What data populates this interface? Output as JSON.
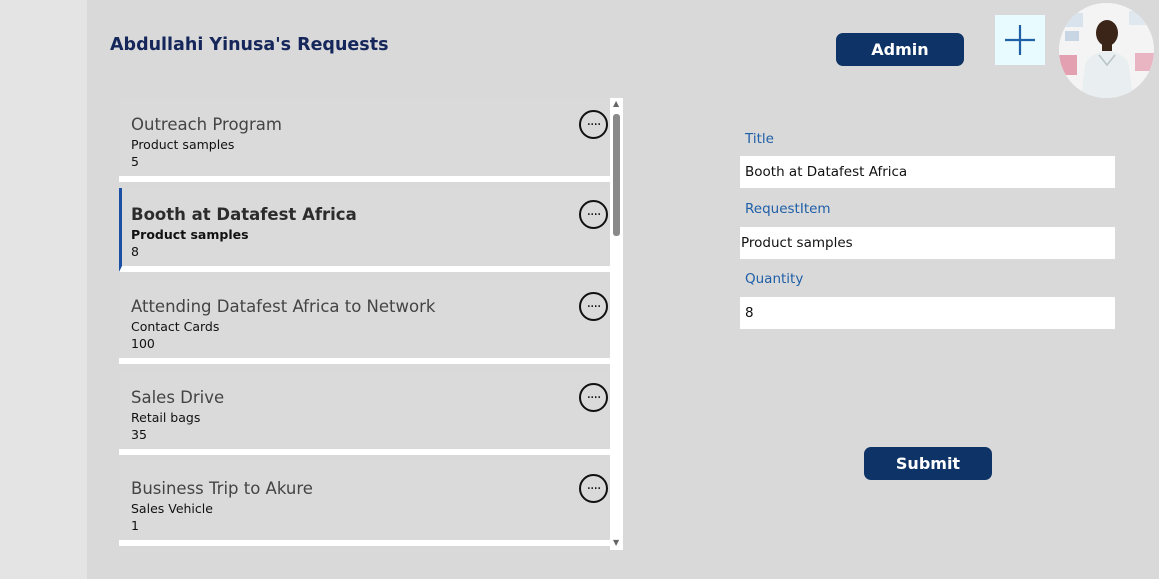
{
  "header": {
    "title": "Abdullahi Yinusa's Requests",
    "admin_label": "Admin",
    "add_icon": "plus-icon",
    "avatar_icon": "user-photo"
  },
  "requests": [
    {
      "title": "Outreach Program",
      "item": "Product samples",
      "quantity": "5"
    },
    {
      "title": "Booth at Datafest Africa",
      "item": "Product samples",
      "quantity": "8"
    },
    {
      "title": "Attending Datafest Africa to Network",
      "item": "Contact Cards",
      "quantity": "100"
    },
    {
      "title": "Sales Drive",
      "item": "Retail bags",
      "quantity": "35"
    },
    {
      "title": "Business Trip to Akure",
      "item": "Sales Vehicle",
      "quantity": "1"
    }
  ],
  "selected_index": 1,
  "form": {
    "title_label": "Title",
    "title_value": "Booth at Datafest Africa",
    "item_label": "RequestItem",
    "item_value": "Product samples",
    "quantity_label": "Quantity",
    "quantity_value": "8",
    "submit_label": "Submit"
  },
  "colors": {
    "accent": "#0e3366",
    "label": "#1f5fa8",
    "selection": "#1b4fa3"
  }
}
